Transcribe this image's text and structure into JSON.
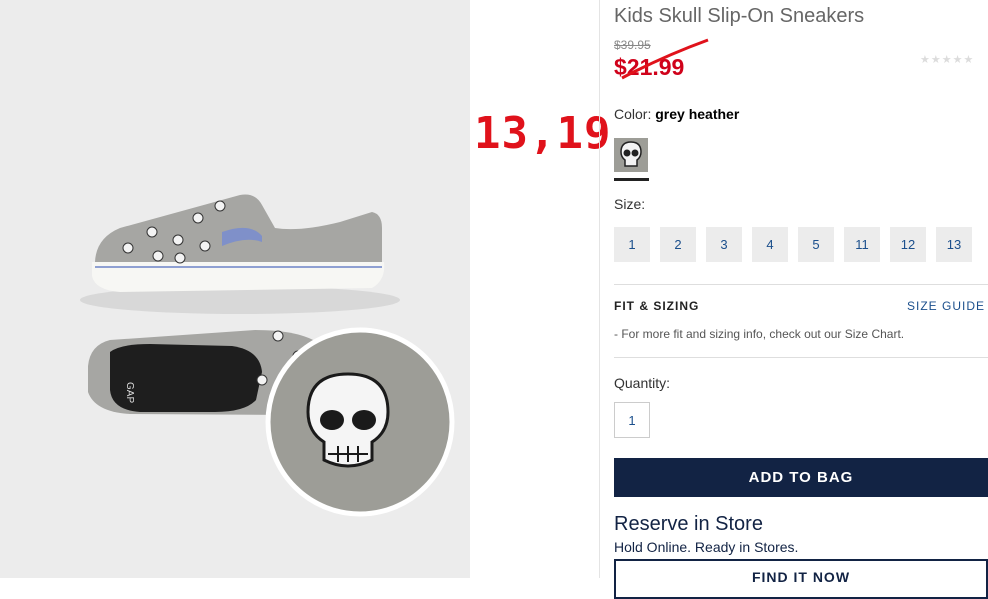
{
  "product": {
    "title": "Kids Skull Slip-On Sneakers",
    "old_price": "$39.95",
    "sale_price": "$21.99",
    "rating_stars": "★★★★★"
  },
  "annotation": "13,19",
  "color": {
    "label": "Color:",
    "value": "grey heather"
  },
  "size": {
    "label": "Size:",
    "options": [
      "1",
      "2",
      "3",
      "4",
      "5",
      "11",
      "12",
      "13"
    ]
  },
  "fit": {
    "title": "FIT & SIZING",
    "guide_link": "SIZE GUIDE",
    "note": "- For more fit and sizing info, check out our Size Chart."
  },
  "quantity": {
    "label": "Quantity:",
    "value": "1"
  },
  "actions": {
    "add_to_bag": "ADD TO BAG",
    "find_it_now": "FIND IT NOW"
  },
  "reserve": {
    "title": "Reserve in Store",
    "subtitle": "Hold Online. Ready in Stores."
  },
  "colors": {
    "navy": "#122344",
    "sale_red": "#d0021b",
    "link_blue": "#1b4f8c",
    "annotation_red": "#e0121b"
  }
}
